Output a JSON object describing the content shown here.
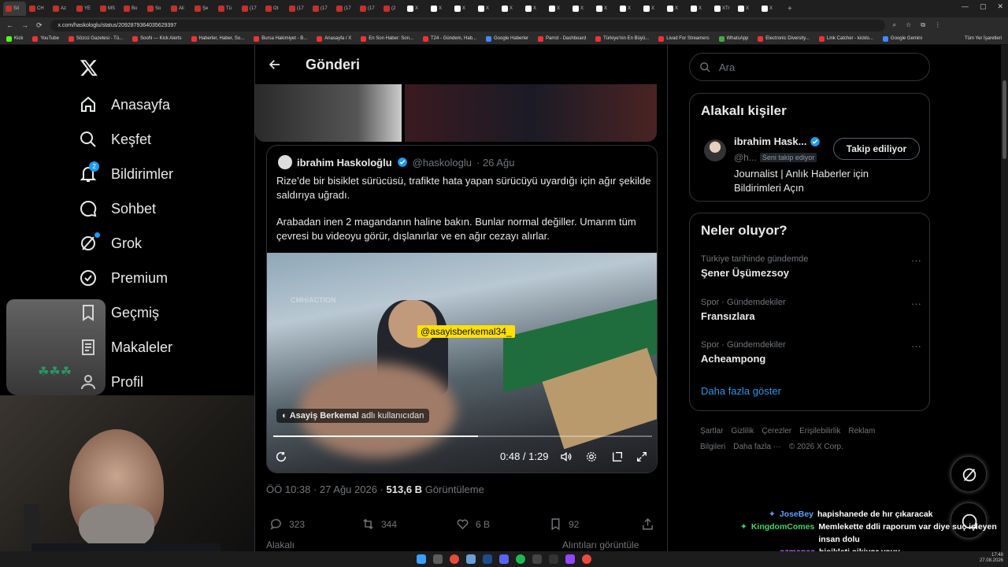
{
  "browser": {
    "tabs": [
      "Sö",
      "CH",
      "Az",
      "YE",
      "MS",
      "Bo",
      "So",
      "Ali",
      "Şe",
      "Tü",
      "(17",
      "Ot",
      "(17",
      "(17",
      "(17",
      "(17",
      "(2",
      "X",
      "X",
      "X",
      "X",
      "X",
      "X",
      "X",
      "X",
      "X",
      "X",
      "X",
      "X",
      "X",
      "XTr",
      "X",
      "X"
    ],
    "url": "x.com/haskologlu/status/2092879364035629397",
    "bookmarks": [
      "Kick",
      "YouTube",
      "Sözcü Gazetesi - Tü...",
      "SooN — Kick Alerts",
      "Haberler, Haber, So...",
      "Bursa Hakimiyet - B...",
      "Anasayfa / X",
      "En Son Haber: Son...",
      "T24 - Gündem, Hab...",
      "Google Haberler",
      "Parrot - Dashboard",
      "Türkiye'nin En Büyü...",
      "Livad For Streamers",
      "WhatsApp",
      "Electronic Diversity...",
      "Link Catcher - kicklo...",
      "Google Gemini"
    ],
    "bookmarks_all": "Tüm Yer İşaretleri"
  },
  "nav": {
    "items": [
      {
        "label": "Anasayfa",
        "icon": "home-icon"
      },
      {
        "label": "Keşfet",
        "icon": "search-icon"
      },
      {
        "label": "Bildirimler",
        "icon": "bell-icon",
        "badge": "2"
      },
      {
        "label": "Sohbet",
        "icon": "chat-icon"
      },
      {
        "label": "Grok",
        "icon": "grok-icon"
      },
      {
        "label": "Premium",
        "icon": "premium-icon"
      },
      {
        "label": "Geçmiş",
        "icon": "bookmark-icon"
      },
      {
        "label": "Makaleler",
        "icon": "article-icon"
      },
      {
        "label": "Profil",
        "icon": "profile-icon"
      }
    ]
  },
  "post": {
    "header_title": "Gönderi",
    "quote": {
      "name": "ibrahim Haskoloğlu",
      "handle": "@haskologlu",
      "date": "· 26 Ağu",
      "text1": "Rize’de bir bisiklet sürücüsü, trafikte hata yapan sürücüyü uyardığı için ağır şekilde saldırıya uğradı.",
      "text2": "Arabadan inen 2 magandanın haline bakın. Bunlar normal değiller. Umarım tüm çevresi bu videoyu görür, dışlanırlar ve en ağır cezayı alırlar.",
      "video": {
        "tag": "@asayisberkemal34_",
        "watermark": "CMH/ACTION",
        "source_name": "Asayiş Berkemal",
        "source_suffix": "adlı kullanıcıdan",
        "time": "0:48 / 1:29",
        "progress": 0.54
      }
    },
    "timestamp": "ÖÖ 10:38 · 27 Ağu 2026 ·",
    "views": "513,6 B",
    "views_label": "Görüntüleme",
    "replies": "323",
    "reposts": "344",
    "likes": "6 B",
    "bookmarks": "92",
    "related_left": "Alakalı",
    "related_right": "Alıntıları görüntüle"
  },
  "right": {
    "search_placeholder": "Ara",
    "related_title": "Alakalı kişiler",
    "person": {
      "name": "ibrahim Hask...",
      "handle": "@h...",
      "follows_you": "Seni takip ediyor",
      "follow_label": "Takip ediliyor",
      "bio": "Journalist | Anlık Haberler için Bildirimleri Açın"
    },
    "trends_title": "Neler oluyor?",
    "trends": [
      {
        "context": "Türkiye tarihinde gündemde",
        "name": "Şener Üşümezsoy"
      },
      {
        "context": "Spor · Gündemdekiler",
        "name": "Fransızlara"
      },
      {
        "context": "Spor · Gündemdekiler",
        "name": "Acheampong"
      }
    ],
    "show_more": "Daha fazla göster",
    "footer": [
      "Şartlar",
      "Gizlilik",
      "Çerezler",
      "Erişilebilirlik",
      "Reklam Bilgileri",
      "Daha fazla ···",
      "© 2026 X Corp."
    ]
  },
  "chat": [
    {
      "user": "JoseBey",
      "msg": "hapishanede de hır çıkaracak"
    },
    {
      "user": "KingdomComes",
      "msg": "Memlekette ddli raporum var diye suç işleyen insan dolu"
    },
    {
      "user": "ozmancc",
      "msg": "bisikleti sikiyor yauv"
    }
  ],
  "clock": {
    "time": "17:48",
    "date": "27.08.2026"
  },
  "colors": {
    "accent": "#1d9bf0",
    "background": "#000000",
    "border": "#2f3336",
    "muted": "#71767b"
  }
}
